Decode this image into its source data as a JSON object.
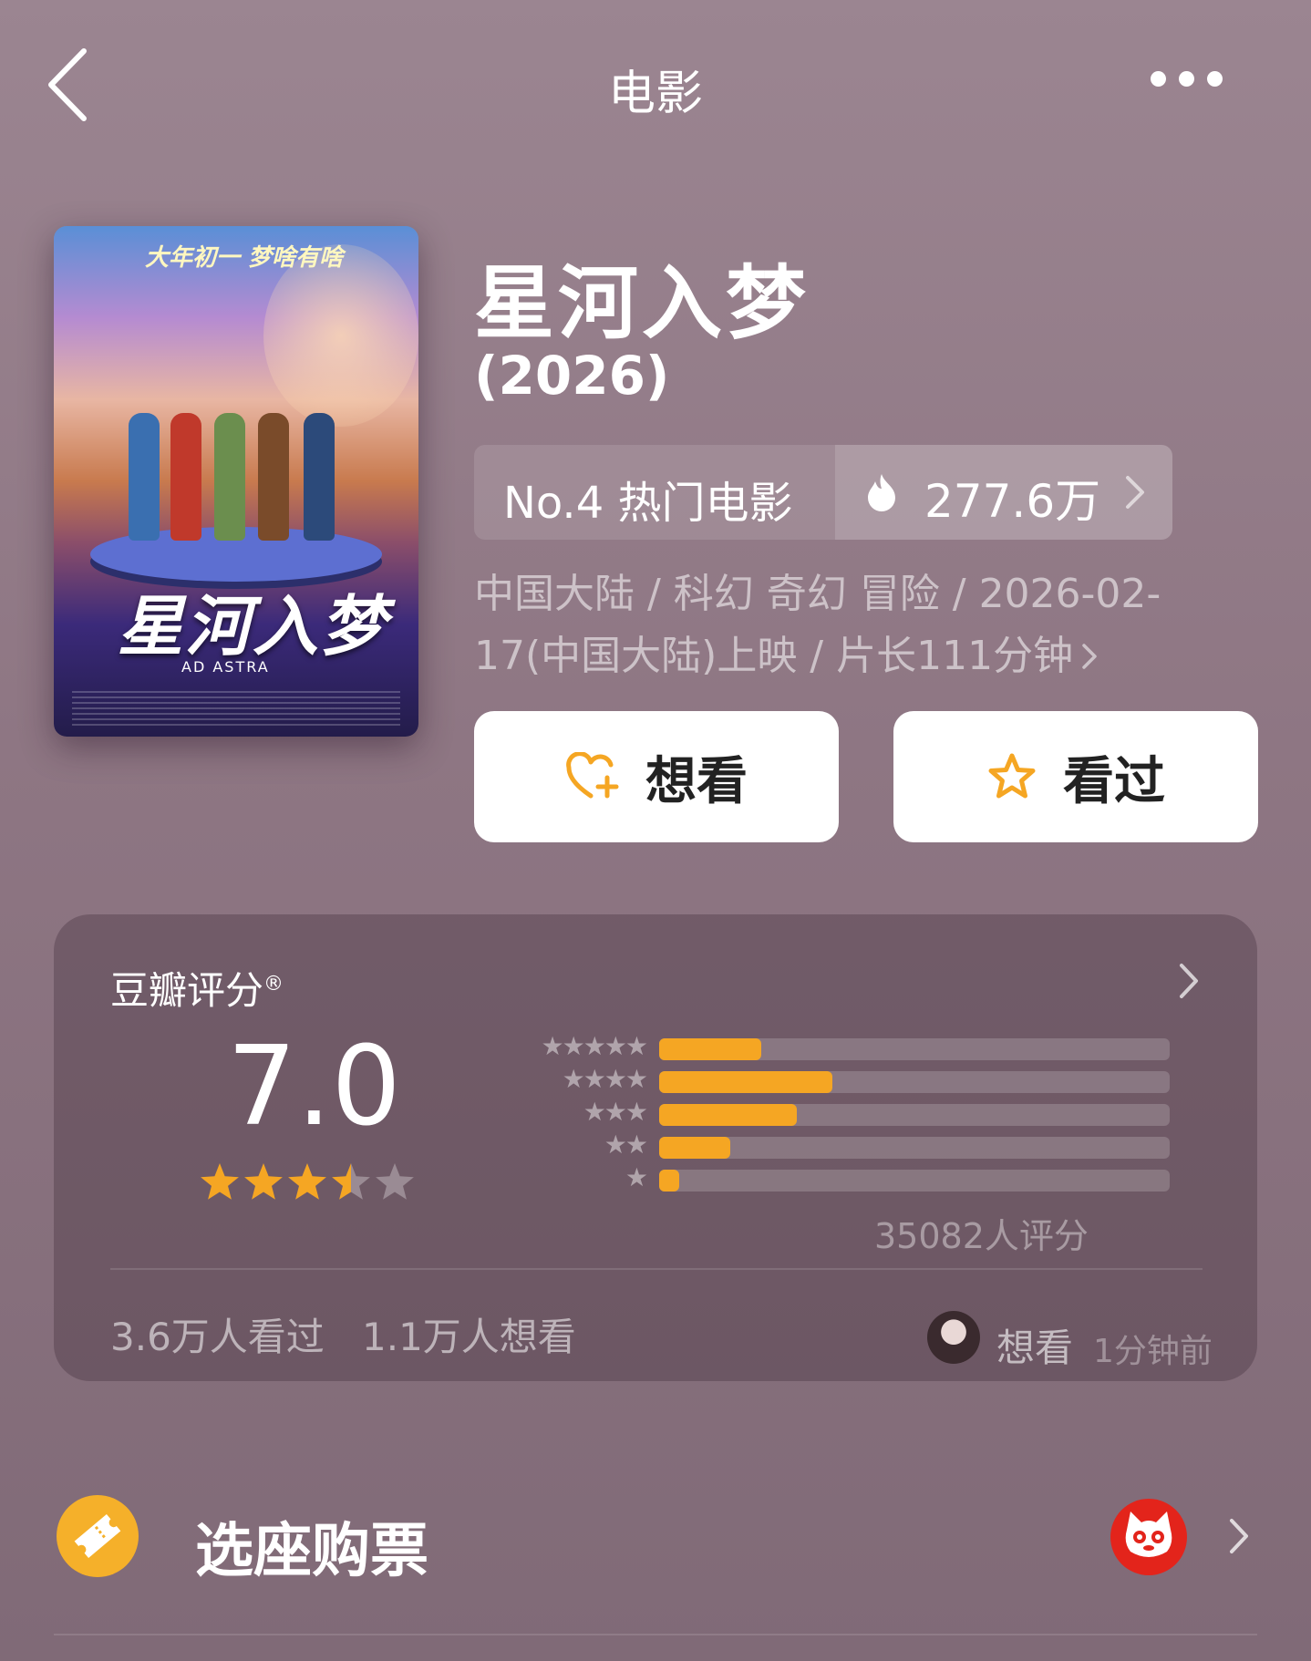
{
  "nav": {
    "title": "电影",
    "back_icon": "chevron-left-icon",
    "more_icon": "more-horizontal-icon"
  },
  "poster": {
    "tagline": "大年初一 梦啥有啥",
    "title_art": "星河入梦",
    "subtitle_art": "AD ASTRA"
  },
  "movie": {
    "title": "星河入梦",
    "year": "(2026)"
  },
  "rank": {
    "label": "No.4 热门电影",
    "heat": "277.6万",
    "heat_icon": "fire-icon"
  },
  "meta": {
    "text": "中国大陆 / 科幻 奇幻 冒险 / 2026-02-17(中国大陆)上映 / 片长111分钟"
  },
  "actions": {
    "want": "想看",
    "seen": "看过"
  },
  "rating": {
    "label": "豆瓣评分",
    "registered_mark": "®",
    "score": "7.0",
    "stars": 3.5,
    "distribution": [
      {
        "stars": 5,
        "fraction": 0.2
      },
      {
        "stars": 4,
        "fraction": 0.34
      },
      {
        "stars": 3,
        "fraction": 0.27
      },
      {
        "stars": 2,
        "fraction": 0.14
      },
      {
        "stars": 1,
        "fraction": 0.04
      }
    ],
    "count": "35082人评分",
    "seen_count": "3.6万人看过",
    "want_count": "1.1万人想看",
    "activity_text": "想看",
    "activity_time": "1分钟前"
  },
  "ticket": {
    "label": "选座购票",
    "icon": "ticket-icon",
    "partner_icon": "cat-logo-icon"
  },
  "colors": {
    "accent": "#f5a623",
    "background": "#8e7683",
    "partner": "#e3241b"
  }
}
